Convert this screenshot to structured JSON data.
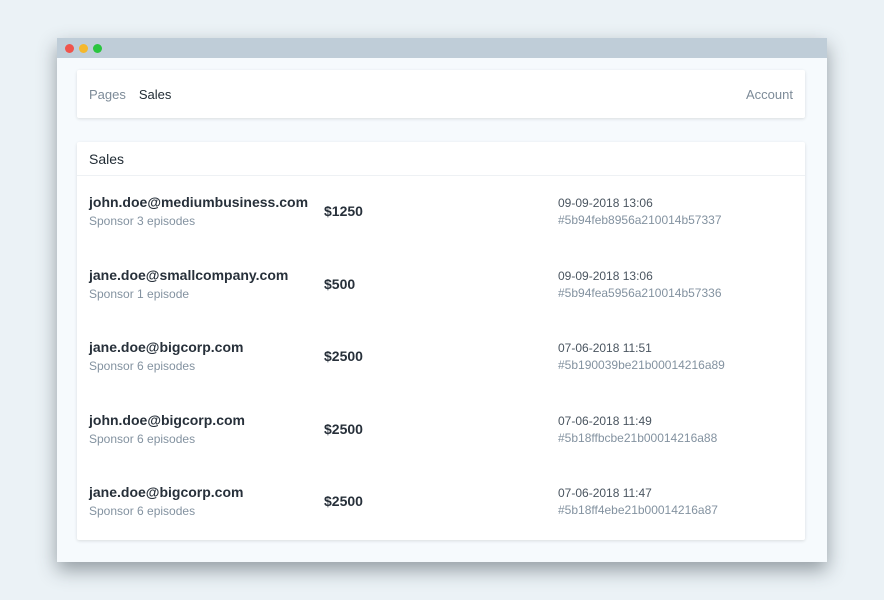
{
  "nav": {
    "links": [
      {
        "label": "Pages"
      },
      {
        "label": "Sales"
      }
    ],
    "account_label": "Account"
  },
  "sales": {
    "title": "Sales",
    "rows": [
      {
        "email": "john.doe@mediumbusiness.com",
        "description": "Sponsor 3 episodes",
        "amount": "$1250",
        "date": "09-09-2018 13:06",
        "id": "#5b94feb8956a210014b57337"
      },
      {
        "email": "jane.doe@smallcompany.com",
        "description": "Sponsor 1 episode",
        "amount": "$500",
        "date": "09-09-2018 13:06",
        "id": "#5b94fea5956a210014b57336"
      },
      {
        "email": "jane.doe@bigcorp.com",
        "description": "Sponsor 6 episodes",
        "amount": "$2500",
        "date": "07-06-2018 11:51",
        "id": "#5b190039be21b00014216a89"
      },
      {
        "email": "john.doe@bigcorp.com",
        "description": "Sponsor 6 episodes",
        "amount": "$2500",
        "date": "07-06-2018 11:49",
        "id": "#5b18ffbcbe21b00014216a88"
      },
      {
        "email": "jane.doe@bigcorp.com",
        "description": "Sponsor 6 episodes",
        "amount": "$2500",
        "date": "07-06-2018 11:47",
        "id": "#5b18ff4ebe21b00014216a87"
      }
    ]
  }
}
